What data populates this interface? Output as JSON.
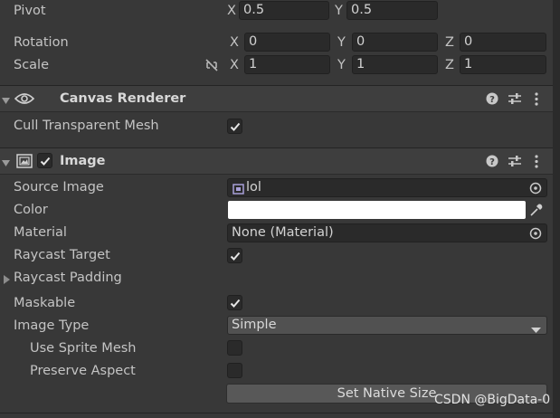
{
  "transform": {
    "pivot": {
      "label": "Pivot",
      "x_axis": "X",
      "x": "0.5",
      "y_axis": "Y",
      "y": "0.5"
    },
    "rotation": {
      "label": "Rotation",
      "x_axis": "X",
      "x": "0",
      "y_axis": "Y",
      "y": "0",
      "z_axis": "Z",
      "z": "0"
    },
    "scale": {
      "label": "Scale",
      "x_axis": "X",
      "x": "1",
      "y_axis": "Y",
      "y": "1",
      "z_axis": "Z",
      "z": "1"
    }
  },
  "canvas_renderer": {
    "title": "Canvas Renderer",
    "cull_label": "Cull Transparent Mesh",
    "cull_checked": true
  },
  "image": {
    "title": "Image",
    "enabled": true,
    "source_image_label": "Source Image",
    "source_image_value": "lol",
    "color_label": "Color",
    "color_value": "#ffffff",
    "material_label": "Material",
    "material_value": "None (Material)",
    "raycast_target_label": "Raycast Target",
    "raycast_target_checked": true,
    "raycast_padding_label": "Raycast Padding",
    "maskable_label": "Maskable",
    "maskable_checked": true,
    "image_type_label": "Image Type",
    "image_type_value": "Simple",
    "use_sprite_mesh_label": "Use Sprite Mesh",
    "use_sprite_mesh_checked": false,
    "preserve_aspect_label": "Preserve Aspect",
    "preserve_aspect_checked": false,
    "set_native_size_label": "Set Native Size"
  },
  "watermark": "CSDN @BigData-0",
  "icons": {
    "help": "help-icon",
    "presets": "presets-icon",
    "menu": "kebab-menu-icon",
    "eye": "eye-icon",
    "image_component": "image-component-icon",
    "object_picker": "object-picker-icon",
    "eyedropper": "eyedropper-icon",
    "constrain": "constrain-proportions-icon",
    "foldout": "foldout-arrow-icon",
    "dropdown": "dropdown-arrow-icon",
    "sprite": "sprite-icon"
  }
}
